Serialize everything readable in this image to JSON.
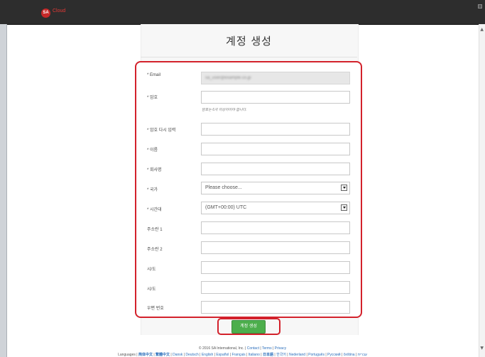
{
  "app": {
    "logo_badge": "SA",
    "logo_text": "Cloud"
  },
  "page": {
    "title": "계정 생성"
  },
  "form": {
    "email_label": "* Email",
    "email_value": "sa_user@example.co.jp",
    "password_label": "* 암호",
    "password_hint": "암호는 6자 이상이어야 합니다.",
    "password_confirm_label": "* 암호 다시 입력",
    "name_label": "* 이름",
    "company_label": "* 회사명",
    "country_label": "* 국가",
    "country_value": "Please choose...",
    "timezone_label": "* 시간대",
    "timezone_value": "(GMT+00:00) UTC",
    "address1_label": "주소란 1",
    "address2_label": "주소란 2",
    "city_label": "시/도",
    "state_label": "시/도",
    "zip_label": "우편 번호",
    "submit_label": "계정 생성"
  },
  "footer": {
    "copyright": "© 2016 SA International, Inc. |",
    "contact": "Contact",
    "terms": "Terms",
    "privacy": "Privacy",
    "languages_label": "Languages |",
    "languages": [
      "简体中文",
      "繁體中文",
      "Dansk",
      "Deutsch",
      "English",
      "Español",
      "Français",
      "Italiano",
      "日本語",
      "한국어",
      "Nederland",
      "Português",
      "Русский",
      "čeština",
      "עברית"
    ]
  }
}
